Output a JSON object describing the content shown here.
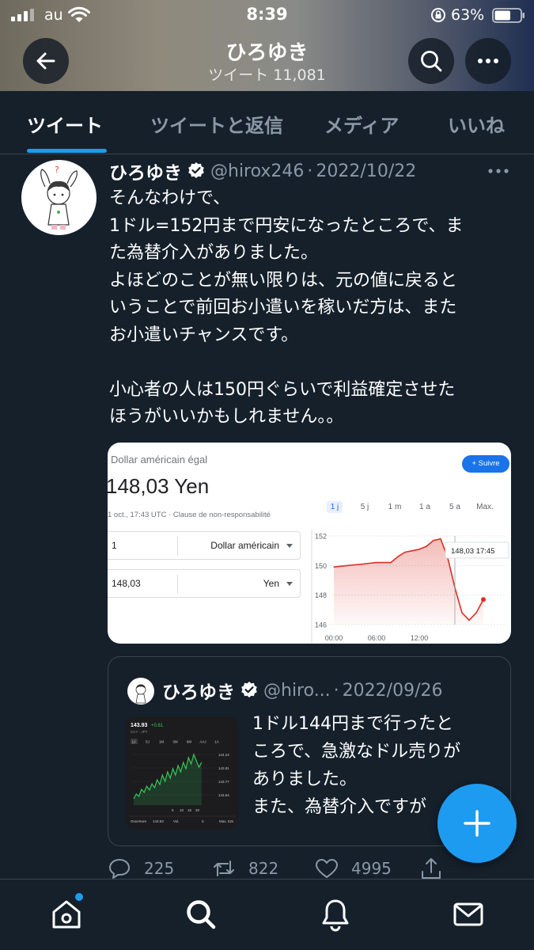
{
  "status_bar": {
    "carrier": "au",
    "time": "8:39",
    "battery_percent": "63%",
    "battery_level": 0.63
  },
  "profile": {
    "name": "ひろゆき",
    "tweet_count": "ツイート 11,081"
  },
  "tabs": [
    {
      "label": "ツイート",
      "active": true
    },
    {
      "label": "ツイートと返信",
      "active": false
    },
    {
      "label": "メディア",
      "active": false
    },
    {
      "label": "いいね",
      "active": false
    }
  ],
  "tweet": {
    "author": "ひろゆき",
    "handle": "@hirox246",
    "date": "2022/10/22",
    "text_lines": [
      "そんなわけで、",
      "1ドル=152円まで円安になったところで、ま",
      "た為替介入がありました。",
      "よほどのことが無い限りは、元の値に戻ると",
      "いうことで前回お小遣いを稼いだ方は、また",
      "お小遣いチャンスです。",
      "",
      "小心者の人は150円ぐらいで利益確定させた",
      "ほうがいいかもしれません。。"
    ],
    "media": {
      "title": "Dollar américain égal",
      "price": "148,03 Yen",
      "note": "1 oct., 17:43 UTC · Clause de non-responsabilité",
      "follow_label": "Suivre",
      "ranges": [
        "1 j",
        "5 j",
        "1 m",
        "1 a",
        "5 a",
        "Max."
      ],
      "selected_range": "1 j",
      "from_amount": "1",
      "from_currency": "Dollar américain",
      "to_amount": "148,03",
      "to_currency": "Yen",
      "accent_color": "#d93025",
      "chart_data": {
        "type": "area",
        "x_ticks": [
          "00:00",
          "06:00",
          "12:00"
        ],
        "y_ticks": [
          "152",
          "150",
          "148",
          "146"
        ],
        "ylim": [
          146,
          152
        ],
        "x": [
          0,
          2,
          4,
          6,
          8,
          9,
          10,
          11,
          12,
          13,
          14,
          15,
          16,
          17,
          18,
          19,
          20,
          21
        ],
        "y": [
          149.9,
          150.0,
          150.1,
          150.2,
          150.2,
          150.6,
          150.9,
          151.0,
          151.1,
          151.3,
          151.7,
          151.8,
          150.5,
          148.5,
          146.8,
          146.3,
          146.8,
          147.7
        ],
        "tooltip": "148,03  17:45"
      }
    },
    "quote": {
      "author": "ひろゆき",
      "handle": "@hiro...",
      "date": "2022/09/26",
      "text_lines": [
        "1ドル144円まで行ったと",
        "ころで、急激なドル売りが",
        "ありました。",
        "また、為替介入ですが"
      ],
      "thumb": {
        "price": "143.93",
        "change": "+0.61",
        "pair": "CCY · JPY",
        "ranges": [
          "1J",
          "5J",
          "1M",
          "3M",
          "6M",
          "AAJ",
          "1A"
        ],
        "y_ticks": [
          "144.24",
          "143.81",
          "143.77",
          "143.64"
        ],
        "x_ticks": [
          "5",
          "10",
          "15",
          "20"
        ],
        "footer": [
          "Ouverture",
          "143.93",
          "Vol.",
          "0",
          "Max. 52s"
        ]
      }
    },
    "counts": {
      "replies": "225",
      "retweets": "822",
      "likes": "4995"
    }
  }
}
